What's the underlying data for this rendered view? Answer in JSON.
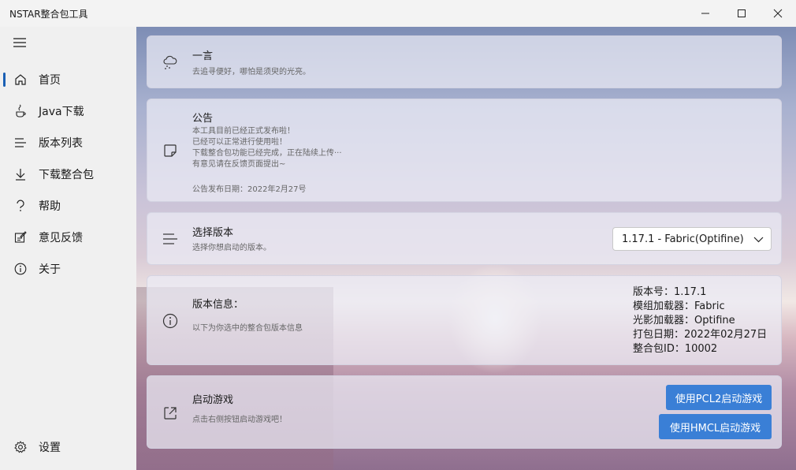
{
  "app": {
    "title": "NSTAR整合包工具"
  },
  "window_controls": {
    "minimize": "minimize-icon",
    "maximize": "maximize-icon",
    "close": "close-icon"
  },
  "sidebar": {
    "items": [
      {
        "label": "首页",
        "icon": "home-icon"
      },
      {
        "label": "Java下载",
        "icon": "java-icon"
      },
      {
        "label": "版本列表",
        "icon": "list-icon"
      },
      {
        "label": "下载整合包",
        "icon": "download-icon"
      },
      {
        "label": "帮助",
        "icon": "help-icon"
      },
      {
        "label": "意见反馈",
        "icon": "feedback-icon"
      },
      {
        "label": "关于",
        "icon": "info-icon"
      }
    ],
    "settings": {
      "label": "设置",
      "icon": "settings-icon"
    }
  },
  "cards": {
    "quote": {
      "title": "一言",
      "text": "去追寻便好，哪怕是须臾的光亮。"
    },
    "notice": {
      "title": "公告",
      "lines": [
        "本工具目前已经正式发布啦！",
        "已经可以正常进行使用啦！",
        "下载整合包功能已经完成，正在陆续上传···",
        "有意见请在反馈页面提出~"
      ],
      "date": "公告发布日期：2022年2月27号"
    },
    "select_version": {
      "title": "选择版本",
      "subtitle": "选择你想启动的版本。",
      "selected": "1.17.1 - Fabric(Optifine)"
    },
    "version_info": {
      "title": "版本信息：",
      "subtitle": "以下为你选中的整合包版本信息",
      "lines": [
        "版本号：1.17.1",
        "模组加载器：Fabric",
        "光影加载器：Optifine",
        "打包日期：2022年02月27日",
        "整合包ID：10002"
      ]
    },
    "launch": {
      "title": "启动游戏",
      "subtitle": "点击右侧按钮启动游戏吧！",
      "pcl2_button": "使用PCL2启动游戏",
      "hmcl_button": "使用HMCL启动游戏"
    }
  }
}
